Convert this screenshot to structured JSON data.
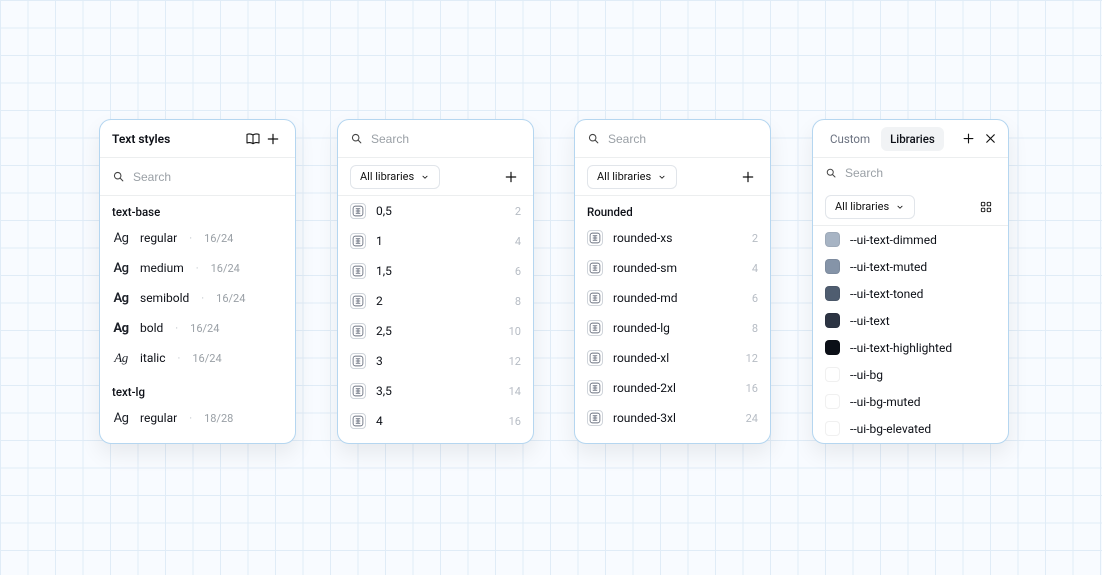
{
  "panel1": {
    "title": "Text styles",
    "search_placeholder": "Search",
    "groups": [
      {
        "label": "text-base",
        "items": [
          {
            "sample_class": "ag-regular",
            "name": "regular",
            "meta": "16/24"
          },
          {
            "sample_class": "ag-medium",
            "name": "medium",
            "meta": "16/24"
          },
          {
            "sample_class": "ag-semibold",
            "name": "semibold",
            "meta": "16/24"
          },
          {
            "sample_class": "ag-bold",
            "name": "bold",
            "meta": "16/24"
          },
          {
            "sample_class": "ag-italic",
            "name": "italic",
            "meta": "16/24"
          }
        ]
      },
      {
        "label": "text-lg",
        "items": [
          {
            "sample_class": "ag-regular",
            "name": "regular",
            "meta": "18/28"
          }
        ]
      }
    ]
  },
  "panel2": {
    "search_placeholder": "Search",
    "filter_label": "All libraries",
    "items": [
      {
        "name": "0,5",
        "value": "2"
      },
      {
        "name": "1",
        "value": "4"
      },
      {
        "name": "1,5",
        "value": "6"
      },
      {
        "name": "2",
        "value": "8"
      },
      {
        "name": "2,5",
        "value": "10"
      },
      {
        "name": "3",
        "value": "12"
      },
      {
        "name": "3,5",
        "value": "14"
      },
      {
        "name": "4",
        "value": "16"
      }
    ]
  },
  "panel3": {
    "search_placeholder": "Search",
    "filter_label": "All libraries",
    "group_label": "Rounded",
    "items": [
      {
        "name": "rounded-xs",
        "value": "2"
      },
      {
        "name": "rounded-sm",
        "value": "4"
      },
      {
        "name": "rounded-md",
        "value": "6"
      },
      {
        "name": "rounded-lg",
        "value": "8"
      },
      {
        "name": "rounded-xl",
        "value": "12"
      },
      {
        "name": "rounded-2xl",
        "value": "16"
      },
      {
        "name": "rounded-3xl",
        "value": "24"
      }
    ]
  },
  "panel4": {
    "tabs": [
      "Custom",
      "Libraries"
    ],
    "active_tab": 1,
    "search_placeholder": "Search",
    "filter_label": "All libraries",
    "items": [
      {
        "name": "--ui-text-dimmed",
        "color": "#a7b4c4"
      },
      {
        "name": "--ui-text-muted",
        "color": "#8594a8"
      },
      {
        "name": "--ui-text-toned",
        "color": "#4f5d70"
      },
      {
        "name": "--ui-text",
        "color": "#2c3443"
      },
      {
        "name": "--ui-text-highlighted",
        "color": "#0b0f17"
      },
      {
        "name": "--ui-bg",
        "color": "#ffffff"
      },
      {
        "name": "--ui-bg-muted",
        "color": "#ffffff"
      },
      {
        "name": "--ui-bg-elevated",
        "color": "#ffffff"
      }
    ]
  }
}
